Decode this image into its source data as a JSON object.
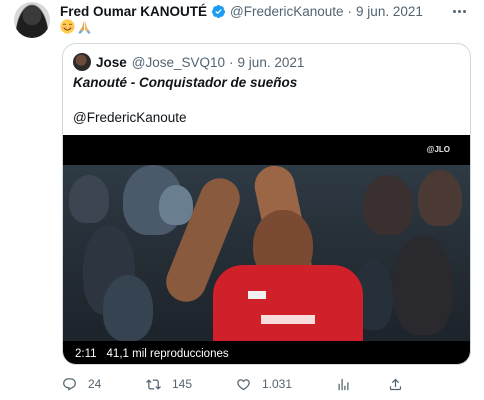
{
  "author": {
    "name": "Fred Oumar KANOUTÉ",
    "handle": "@FredericKanoute",
    "separator": "·",
    "date": "9 jun. 2021",
    "verified_color": "#1d9bf0"
  },
  "tweet": {
    "emojis": [
      "smiling-face-with-smiling-eyes",
      "folded-hands"
    ]
  },
  "quoted": {
    "name": "Jose",
    "handle": "@Jose_SVQ10",
    "separator": "·",
    "date": "9 jun. 2021",
    "text_name": "Kanouté",
    "text_rest": " - Conquistador de sueños",
    "mention": "@FredericKanoute",
    "video": {
      "watermark": "@JLO",
      "duration": "2:11",
      "views": "41,1 mil reproducciones"
    }
  },
  "actions": {
    "replies": "24",
    "retweets": "145",
    "likes": "1.031"
  },
  "colors": {
    "text": "#0f1419",
    "secondary": "#536471",
    "border": "#cfd9de",
    "jersey_red": "#d0202a"
  }
}
